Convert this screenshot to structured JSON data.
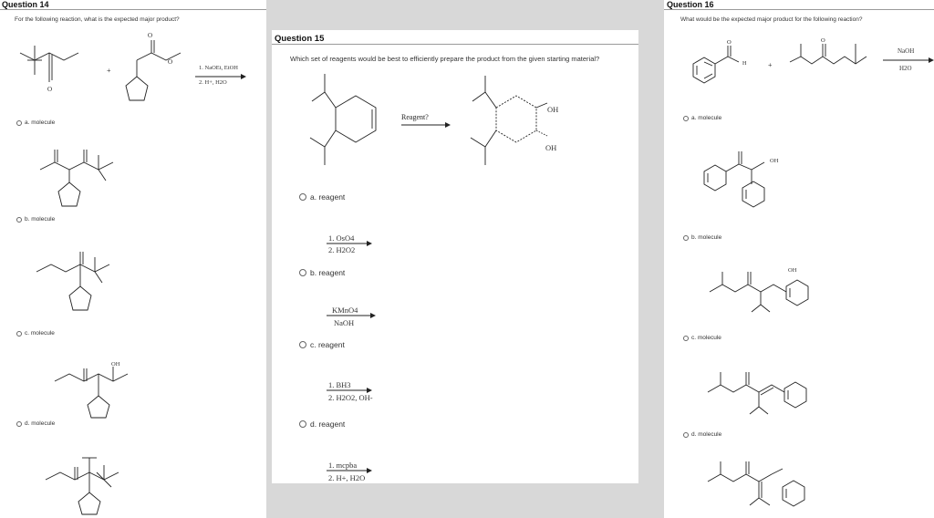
{
  "q14": {
    "title": "Question 14",
    "prompt": "For the following reaction, what is the expected major product?",
    "conditions": [
      "1. NaOEt, EtOH",
      "2. H+, H2O"
    ],
    "options": [
      "a. molecule",
      "b. molecule",
      "c. molecule",
      "d. molecule"
    ]
  },
  "q15": {
    "title": "Question 15",
    "prompt": "Which set of reagents would be best to efficiently prepare the product from the given starting material?",
    "reagent_label": "Reagent?",
    "oh": "OH",
    "options": [
      {
        "label": "a. reagent",
        "lines": [
          "1. OsO4",
          "2. H2O2"
        ]
      },
      {
        "label": "b. reagent",
        "lines": [
          "KMnO4",
          "NaOH"
        ]
      },
      {
        "label": "c. reagent",
        "lines": [
          "1. BH3",
          "2. H2O2, OH-"
        ]
      },
      {
        "label": "d. reagent",
        "lines": [
          "1. mcpba",
          "2. H+, H2O"
        ]
      }
    ]
  },
  "q16": {
    "title": "Question 16",
    "prompt": "What would be the expected major product for the following reaction?",
    "conditions": [
      "NaOH",
      "H2O"
    ],
    "h": "H",
    "o": "O",
    "oh": "OH",
    "options": [
      "a. molecule",
      "b. molecule",
      "c. molecule",
      "d. molecule"
    ]
  },
  "colors": {
    "panel_gray": "#d8d8d8",
    "divider": "#9a9a9a"
  }
}
